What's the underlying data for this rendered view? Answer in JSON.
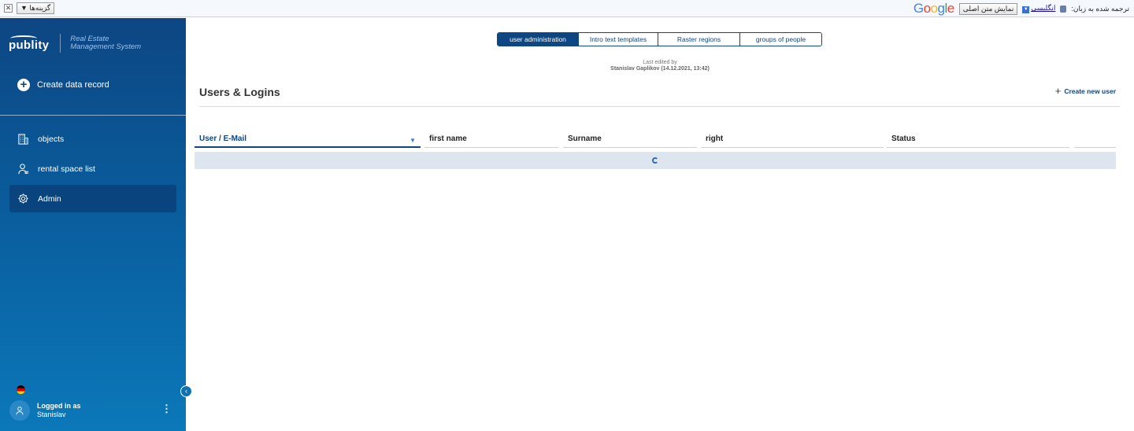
{
  "translate_bar": {
    "close": "✕",
    "options_label": "گزینه‌ها ▼",
    "translated_to": "ترجمه شده به زبان:",
    "language": "انگلیسی",
    "show_original": "نمایش متن اصلی",
    "logo": "Google"
  },
  "brand": {
    "logo": "publity",
    "line1": "Real Estate",
    "line2": "Management System"
  },
  "sidebar": {
    "create_label": "Create data record",
    "items": [
      {
        "label": "objects",
        "icon": "building-icon"
      },
      {
        "label": "rental space list",
        "icon": "user-list-icon"
      },
      {
        "label": "Admin",
        "icon": "gear-icon",
        "active": true
      }
    ],
    "user": {
      "logged_in_label": "Logged in as",
      "name": "Stanislav"
    }
  },
  "tabs": [
    {
      "label": "user administration",
      "active": true
    },
    {
      "label": "Intro text templates"
    },
    {
      "label": "Raster regions"
    },
    {
      "label": "groups of people"
    }
  ],
  "meta": {
    "last_edited_label": "Last edited by",
    "last_edited_by": "Stanislav Gaplikov (14.12.2021, 13:42)"
  },
  "page": {
    "title": "Users & Logins",
    "create_user": "Create new user"
  },
  "table": {
    "columns": [
      "User / E-Mail",
      "first name",
      "Surname",
      "right",
      "Status",
      ""
    ]
  },
  "colors": {
    "brand_primary": "#0d4683",
    "sidebar_bottom": "#0b78b9",
    "loading_row": "#dde5ee"
  }
}
